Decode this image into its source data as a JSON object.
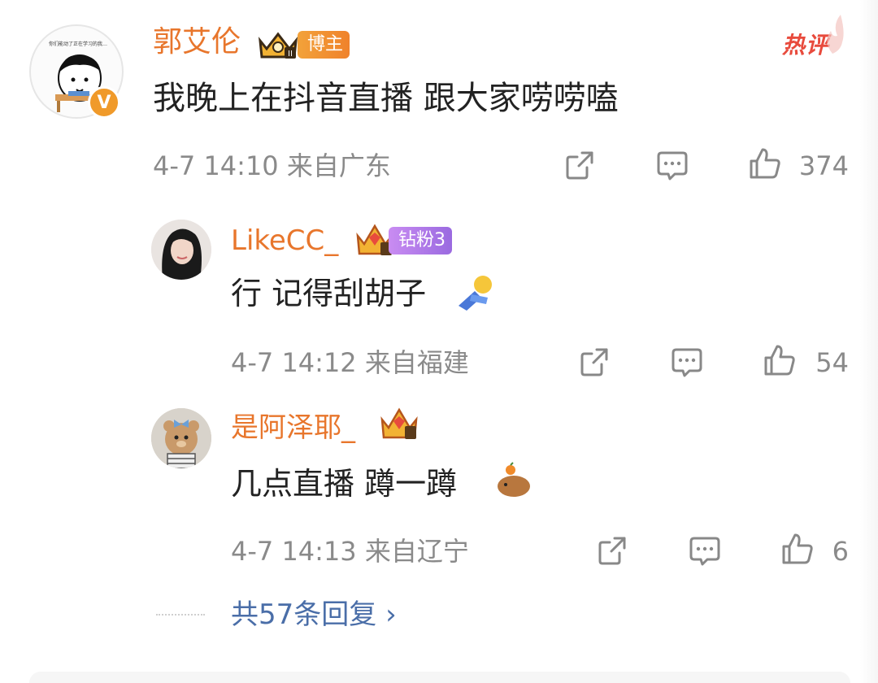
{
  "header": {
    "hot_label": "热评"
  },
  "comment": {
    "username": "郭艾伦",
    "tag": "博主",
    "avatar_caption": "你们能动了正在学习的我…",
    "text": "我晚上在抖音直播 跟大家唠唠嗑",
    "meta": "4-7 14:10 来自广东",
    "likes": "374"
  },
  "replies": [
    {
      "username": "LikeCC_",
      "tag": "钻粉3",
      "text": "行 记得刮胡子",
      "meta": "4-7 14:12 来自福建",
      "likes": "54"
    },
    {
      "username": "是阿泽耶_",
      "tag": "",
      "text": "几点直播 蹲一蹲",
      "meta": "4-7 14:13 来自辽宁",
      "likes": "6"
    }
  ],
  "more_replies": "共57条回复 ›",
  "colors": {
    "username": "#e8762c",
    "link": "#4a6ea8",
    "meta": "#8a8a8a"
  }
}
